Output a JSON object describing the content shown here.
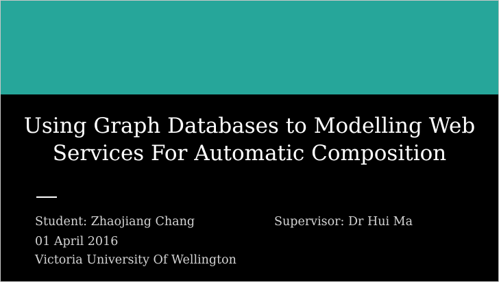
{
  "slide": {
    "colors": {
      "band": "#26a69a",
      "background": "#000000",
      "title_text": "#ffffff",
      "meta_text": "#d4d4d4"
    },
    "title_lines": [
      "Using Graph Databases to Modelling Web",
      "Services For Automatic Composition"
    ],
    "student": "Student: Zhaojiang Chang",
    "supervisor": "Supervisor: Dr Hui Ma",
    "date": "01 April 2016",
    "university": "Victoria University Of Wellington"
  }
}
